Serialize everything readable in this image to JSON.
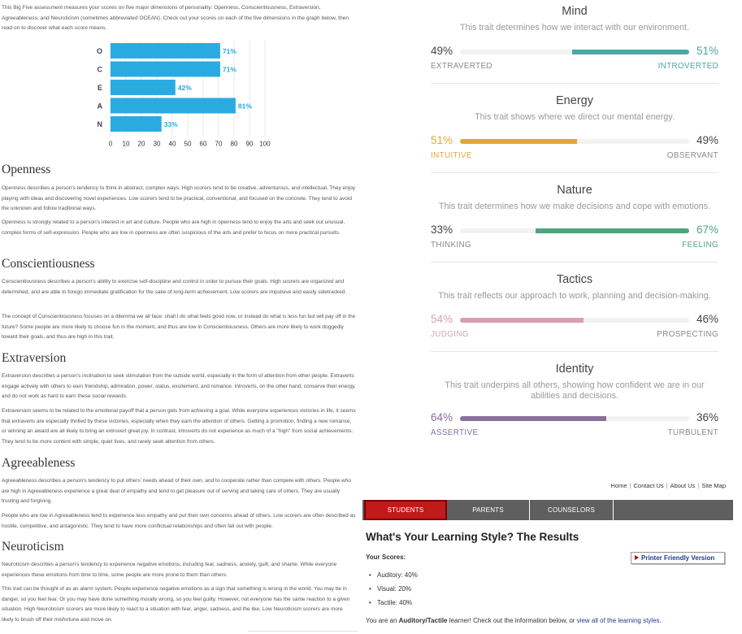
{
  "bigfive": {
    "intro": "This Big Five assessment measures your scores on five major dimensions of personality: Openness, Conscientiousness, Extraversion, Agreeableness, and Neuroticism (sometimes abbreviated OCEAN). Check out your scores on each of the five dimensions in the graph below, then read on to discover what each score means.",
    "sections": [
      {
        "title": "Openness",
        "paragraphs": [
          "Openness describes a person's tendency to think in abstract, complex ways. High scorers tend to be creative, adventurous, and intellectual. They enjoy playing with ideas and discovering novel experiences. Low scorers tend to be practical, conventional, and focused on the concrete. They tend to avoid the unknown and follow traditional ways.",
          "Openness is strongly related to a person's interest in art and culture. People who are high in openness tend to enjoy the arts and seek out unusual, complex forms of self-expression. People who are low in openness are often suspicious of the arts and prefer to focus on more practical pursuits."
        ]
      },
      {
        "title": "Conscientiousness",
        "paragraphs": [
          "Conscientiousness describes a person's ability to exercise self-discipline and control in order to pursue their goals. High scorers are organized and determined, and are able to forego immediate gratification for the sake of long-term achievement. Low scorers are impulsive and easily sidetracked.",
          "The concept of Conscientiousness focuses on a dilemma we all face: shall I do what feels good now, or instead do what is less fun but will pay off in the future? Some people are more likely to choose fun in the moment, and thus are low in Conscientiousness. Others are more likely to work doggedly toward their goals, and thus are high in this trait."
        ]
      },
      {
        "title": "Extraversion",
        "paragraphs": [
          "Extraversion describes a person's inclination to seek stimulation from the outside world, especially in the form of attention from other people. Extraverts engage actively with others to earn friendship, admiration, power, status, excitement, and romance. Introverts, on the other hand, conserve their energy, and do not work as hard to earn these social rewards.",
          "Extraversion seems to be related to the emotional payoff that a person gets from achieving a goal. While everyone experiences victories in life, it seems that extraverts are especially thrilled by these victories, especially when they earn the attention of others. Getting a promotion, finding a new romance, or winning an award are all likely to bring an extrovert great joy. In contrast, introverts do not experience as much of a \"high\" from social achievements. They tend to be more content with simple, quiet lives, and rarely seek attention from others."
        ]
      },
      {
        "title": "Agreeableness",
        "paragraphs": [
          "Agreeableness describes a person's tendency to put others' needs ahead of their own, and to cooperate rather than compete with others. People who are high in Agreeableness experience a great deal of empathy and tend to get pleasure out of serving and taking care of others. They are usually trusting and forgiving.",
          "People who are low in Agreeableness tend to experience less empathy and put their own concerns ahead of others. Low scorers are often described as hostile, competitive, and antagonistic. They tend to have more conflictual relationships and often fall out with people."
        ]
      },
      {
        "title": "Neuroticism",
        "paragraphs": [
          "Neuroticism describes a person's tendency to experience negative emotions, including fear, sadness, anxiety, guilt, and shame. While everyone experiences these emotions from time to time, some people are more prone to them than others.",
          "This trait can be thought of as an alarm system. People experience negative emotions as a sign that something is wrong in the world. You may be in danger, so you feel fear. Or you may have done something morally wrong, so you feel guilty. However, not everyone has the same reaction to a given situation. High Neuroticism scorers are more likely to react to a situation with fear, anger, sadness, and the like. Low Neuroticism scorers are more likely to brush off their misfortune and move on."
        ]
      }
    ]
  },
  "chart_data": {
    "type": "bar",
    "orientation": "horizontal",
    "categories": [
      "O",
      "C",
      "E",
      "A",
      "N"
    ],
    "values": [
      71,
      71,
      42,
      81,
      33
    ],
    "value_labels": [
      "71%",
      "71%",
      "42%",
      "81%",
      "33%"
    ],
    "xticks": [
      0,
      10,
      20,
      30,
      40,
      50,
      60,
      70,
      80,
      90,
      100
    ],
    "xlim": [
      0,
      100
    ],
    "title": "",
    "xlabel": "",
    "ylabel": "",
    "grid": true,
    "bar_color": "#29abe2",
    "label_color": "#29abe2"
  },
  "traits": [
    {
      "name": "Mind",
      "desc": "This trait determines how we interact with our environment.",
      "left_pct": "49%",
      "right_pct": "51%",
      "left_label": "EXTRAVERTED",
      "right_label": "INTROVERTED",
      "value": 51,
      "side": "right",
      "color": "#4ba6a6"
    },
    {
      "name": "Energy",
      "desc": "This trait shows where we direct our mental energy.",
      "left_pct": "51%",
      "right_pct": "49%",
      "left_label": "INTUITIVE",
      "right_label": "OBSERVANT",
      "value": 51,
      "side": "left",
      "color": "#e2a73c"
    },
    {
      "name": "Nature",
      "desc": "This trait determines how we make decisions and cope with emotions.",
      "left_pct": "33%",
      "right_pct": "67%",
      "left_label": "THINKING",
      "right_label": "FEELING",
      "value": 67,
      "side": "right",
      "color": "#4fa37f"
    },
    {
      "name": "Tactics",
      "desc": "This trait reflects our approach to work, planning and decision-making.",
      "left_pct": "54%",
      "right_pct": "46%",
      "left_label": "JUDGING",
      "right_label": "PROSPECTING",
      "value": 54,
      "side": "left",
      "color": "#d59fb6"
    },
    {
      "name": "Identity",
      "desc": "This trait underpins all others, showing how confident we are in our abilities and decisions.",
      "left_pct": "64%",
      "right_pct": "36%",
      "left_label": "ASSERTIVE",
      "right_label": "TURBULENT",
      "value": 64,
      "side": "left",
      "color": "#8a6e9a"
    }
  ],
  "learning": {
    "toplinks": [
      "Home",
      "Contact Us",
      "About Us",
      "Site Map"
    ],
    "tabs": [
      "STUDENTS",
      "PARENTS",
      "COUNSELORS"
    ],
    "title": "What's Your Learning Style? The Results",
    "scores_heading": "Your Scores:",
    "printer_label": "Printer Friendly Version",
    "scores": [
      "Auditory: 40%",
      "Visual: 20%",
      "Tactile: 40%"
    ],
    "result_pre": "You are an ",
    "result_type": "Auditory/Tactile",
    "result_mid": " learner! Check out the information below, or ",
    "result_link": "view all of the learning styles",
    "result_end": ".",
    "colors": {
      "active_tab": "#c01a1a",
      "tab_bar": "#5f5f5f",
      "link": "#1f3c88"
    }
  }
}
